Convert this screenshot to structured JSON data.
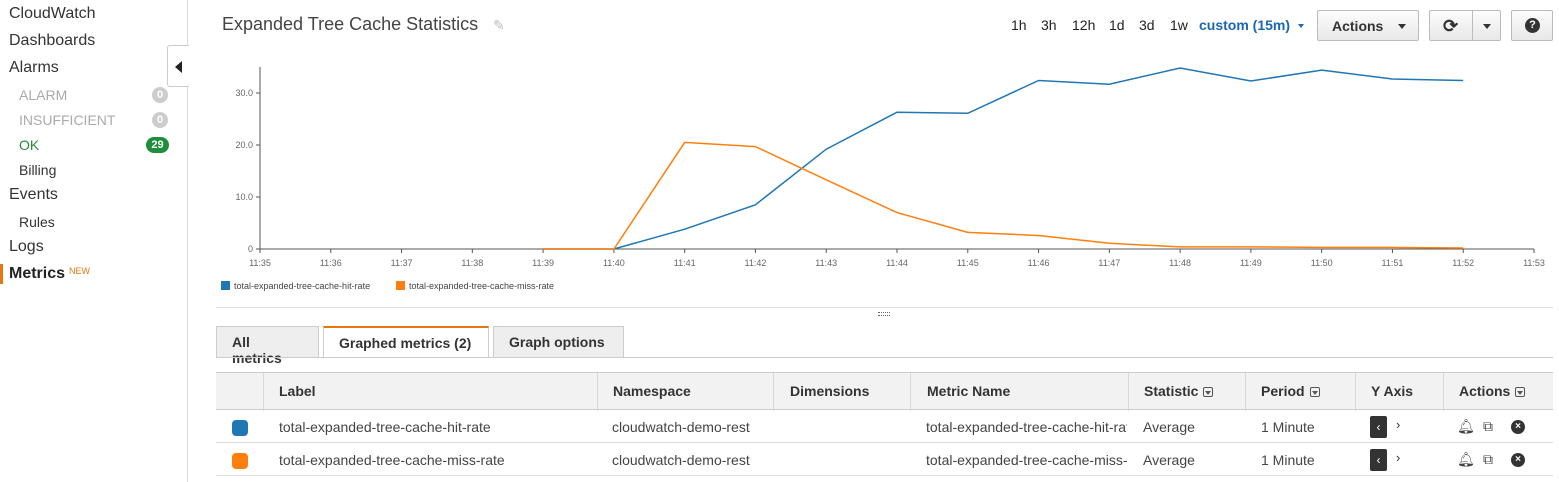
{
  "sidebar": {
    "cloudwatch": "CloudWatch",
    "dashboards": "Dashboards",
    "alarms": "Alarms",
    "alarm_states": [
      {
        "label": "ALARM",
        "count": "0"
      },
      {
        "label": "INSUFFICIENT",
        "count": "0"
      },
      {
        "label": "OK",
        "count": "29"
      }
    ],
    "billing": "Billing",
    "events": "Events",
    "rules": "Rules",
    "logs": "Logs",
    "metrics": "Metrics",
    "metrics_tag": "NEW"
  },
  "header": {
    "title": "Expanded Tree Cache Statistics",
    "ranges": [
      "1h",
      "3h",
      "12h",
      "1d",
      "3d",
      "1w"
    ],
    "custom_range": "custom (15m)",
    "actions_label": "Actions",
    "refresh_icon": "refresh-icon",
    "help_icon": "help-icon"
  },
  "colors": {
    "hit": "#1f77b4",
    "miss": "#ff7f0e",
    "accent": "#e47911",
    "link": "#1a66b8",
    "ok_badge": "#1d8f3a"
  },
  "chart_data": {
    "type": "line",
    "x": [
      "11:35",
      "11:36",
      "11:37",
      "11:38",
      "11:39",
      "11:40",
      "11:41",
      "11:42",
      "11:43",
      "11:44",
      "11:45",
      "11:46",
      "11:47",
      "11:48",
      "11:49",
      "11:50",
      "11:51",
      "11:52",
      "11:53"
    ],
    "yticks": [
      "0",
      "10.0",
      "20.0",
      "30.0"
    ],
    "ylim": [
      0,
      35
    ],
    "series": [
      {
        "name": "total-expanded-tree-cache-hit-rate",
        "color": "#1f77b4",
        "values": [
          null,
          null,
          null,
          null,
          0,
          0,
          3.8,
          8.5,
          19.2,
          26.3,
          26.1,
          32.4,
          31.7,
          34.8,
          32.3,
          34.4,
          32.7,
          32.4,
          null
        ]
      },
      {
        "name": "total-expanded-tree-cache-miss-rate",
        "color": "#ff7f0e",
        "values": [
          null,
          null,
          null,
          null,
          0,
          0,
          20.5,
          19.7,
          13.3,
          7.0,
          3.2,
          2.6,
          1.1,
          0.4,
          0.4,
          0.3,
          0.3,
          0.2,
          null
        ]
      }
    ],
    "grid": false,
    "legend": "bottom-left"
  },
  "tabs": [
    "All metrics",
    "Graphed metrics (2)",
    "Graph options"
  ],
  "table": {
    "headers": [
      "Label",
      "Namespace",
      "Dimensions",
      "Metric Name",
      "Statistic",
      "Period",
      "Y Axis",
      "Actions"
    ],
    "rows": [
      {
        "label": "total-expanded-tree-cache-hit-rate",
        "namespace": "cloudwatch-demo-rest",
        "dimensions": "",
        "metric": "total-expanded-tree-cache-hit-rate",
        "statistic": "Average",
        "period": "1 Minute",
        "color": "#1f77b4"
      },
      {
        "label": "total-expanded-tree-cache-miss-rate",
        "namespace": "cloudwatch-demo-rest",
        "dimensions": "",
        "metric": "total-expanded-tree-cache-miss-rate",
        "statistic": "Average",
        "period": "1 Minute",
        "color": "#ff7f0e"
      }
    ]
  }
}
